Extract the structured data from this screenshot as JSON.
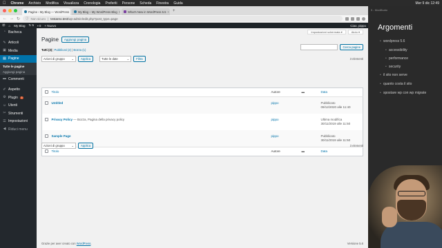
{
  "mac_menubar": {
    "apple_icon": "apple-icon",
    "app": "Chrome",
    "menus": [
      "Archivio",
      "Modifica",
      "Visualizza",
      "Cronologia",
      "Preferiti",
      "Persone",
      "Scheda",
      "Finestra",
      "Guida"
    ],
    "clock": "Mer 9 dic 12:49"
  },
  "browser": {
    "tabs": [
      {
        "title": "Pagine ‹ My Blog — WordPress",
        "active": true
      },
      {
        "title": "My Blog – My WordPress Blog",
        "active": false
      },
      {
        "title": "What's New in WordPress 5.5",
        "active": false
      }
    ],
    "new_tab": "+",
    "url": {
      "warning": "Non sicuro",
      "domain": "testareo.test",
      "path": "/wp-admin/edit.php?post_type=page"
    }
  },
  "admin_bar": {
    "site": "My Blog",
    "updates": "5",
    "comments": "0",
    "new": "+ Nuovo",
    "greeting": "Ciao, pippo"
  },
  "sidebar": {
    "items": [
      {
        "label": "Bacheca",
        "icon": "dashboard-icon"
      },
      {
        "label": "Articoli",
        "icon": "pin-icon"
      },
      {
        "label": "Media",
        "icon": "media-icon"
      },
      {
        "label": "Pagine",
        "icon": "page-icon",
        "active": true
      },
      {
        "label": "Commenti",
        "icon": "comment-icon"
      },
      {
        "label": "Aspetto",
        "icon": "brush-icon"
      },
      {
        "label": "Plugin",
        "icon": "plugin-icon",
        "badge": "3"
      },
      {
        "label": "Utenti",
        "icon": "user-icon"
      },
      {
        "label": "Strumenti",
        "icon": "wrench-icon"
      },
      {
        "label": "Impostazioni",
        "icon": "settings-icon"
      },
      {
        "label": "Riduci menu",
        "icon": "collapse-icon"
      }
    ],
    "submenu": [
      "Tutte le pagine",
      "Aggiungi pagina"
    ]
  },
  "main": {
    "screen_options": "Impostazioni schermata ▾",
    "help": "Aiuto ▾",
    "title": "Pagine",
    "add_new": "Aggiungi pagina",
    "views": {
      "all": "Tutti",
      "all_count": "(3)",
      "published": "Pubblicati",
      "published_count": "(2)",
      "draft": "Bozza",
      "draft_count": "(1)",
      "sep": "|"
    },
    "search_button": "Cerca pagine",
    "bulk_actions": "Azioni di gruppo",
    "apply": "Applica",
    "all_dates": "Tutte le date",
    "filter": "Filtra",
    "items_count": "3 elementi",
    "columns": {
      "title": "Titolo",
      "author": "Autore",
      "date": "Data"
    },
    "rows": [
      {
        "title": "Untitled",
        "state": "",
        "author": "pippo",
        "status": "Pubblicato",
        "date": "09/12/2020 alle 11:40"
      },
      {
        "title": "Privacy Policy",
        "state": " — Bozza, Pagina della privacy policy",
        "author": "pippo",
        "status": "Ultima modifica",
        "date": "30/11/2019 alle 11:50"
      },
      {
        "title": "Sample Page",
        "state": "",
        "author": "pippo",
        "status": "Pubblicato",
        "date": "30/11/2019 alle 11:50"
      }
    ],
    "footer_text": "Grazie per aver creato con",
    "footer_link": "WordPress",
    "version": "Versione 5.6"
  },
  "slide": {
    "header": "5 - Modificato",
    "heading": "Argomenti",
    "bullets": [
      {
        "text": "wordpress 5.6",
        "sub": false
      },
      {
        "text": "accessibility",
        "sub": true
      },
      {
        "text": "performance",
        "sub": true
      },
      {
        "text": "security",
        "sub": true
      },
      {
        "text": "il sito non serve",
        "sub": false
      },
      {
        "text": "quanto costa il sito",
        "sub": false
      },
      {
        "text": "spostare wp con wp migrate",
        "sub": false
      }
    ]
  },
  "colors": {
    "wp_blue": "#0073aa",
    "sidebar_bg": "#23282d",
    "active": "#0073aa"
  }
}
